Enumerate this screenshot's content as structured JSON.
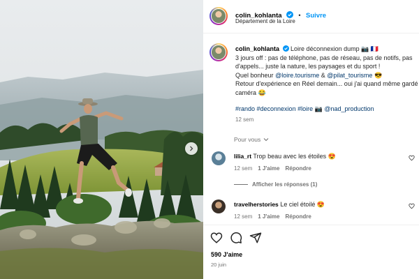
{
  "header": {
    "username": "colin_kohlanta",
    "separator": "•",
    "follow_label": "Suivre",
    "location": "Département de la Loire"
  },
  "caption": {
    "username": "colin_kohlanta",
    "title": "Loire déconnexion dump 📷 🇫🇷",
    "line1": "3 jours off : pas de téléphone, pas de réseau, pas de notifs, pas",
    "line2": "d'appels... juste la nature, les paysages et du sport !",
    "line3_prefix": "Quel bonheur",
    "mention1": "@loire.tourisme",
    "amp": "&",
    "mention2": "@pilat_tourisme",
    "line3_emoji": "😎",
    "line4": "Retour d'expérience en Réel demain... oui j'ai quand même gardé",
    "line5": "caméra 😂",
    "hashtags": "#rando #deconnexion #loire",
    "hashtags_emoji": "📷",
    "mention3": "@nad_production",
    "age": "12 sem"
  },
  "for_you": {
    "label": "Pour vous"
  },
  "comments": [
    {
      "username": "lilia_rt",
      "text": "Trop beau avec les étoiles 😍",
      "age": "12 sem",
      "likes": "1 J'aime",
      "reply": "Répondre",
      "replies_label": "Afficher les réponses (1)"
    },
    {
      "username": "travelherstories",
      "text": "Le ciel étoilé 😍",
      "age": "12 sem",
      "likes": "1 J'aime",
      "reply": "Répondre"
    }
  ],
  "actions": {
    "likes": "590 J'aime",
    "date": "20 juin",
    "like_icon": "heart-icon",
    "comment_icon": "comment-icon",
    "share_icon": "share-icon"
  },
  "colors": {
    "link": "#00376b",
    "follow": "#0095f6",
    "muted": "#737373",
    "verified": "#0095f6"
  }
}
